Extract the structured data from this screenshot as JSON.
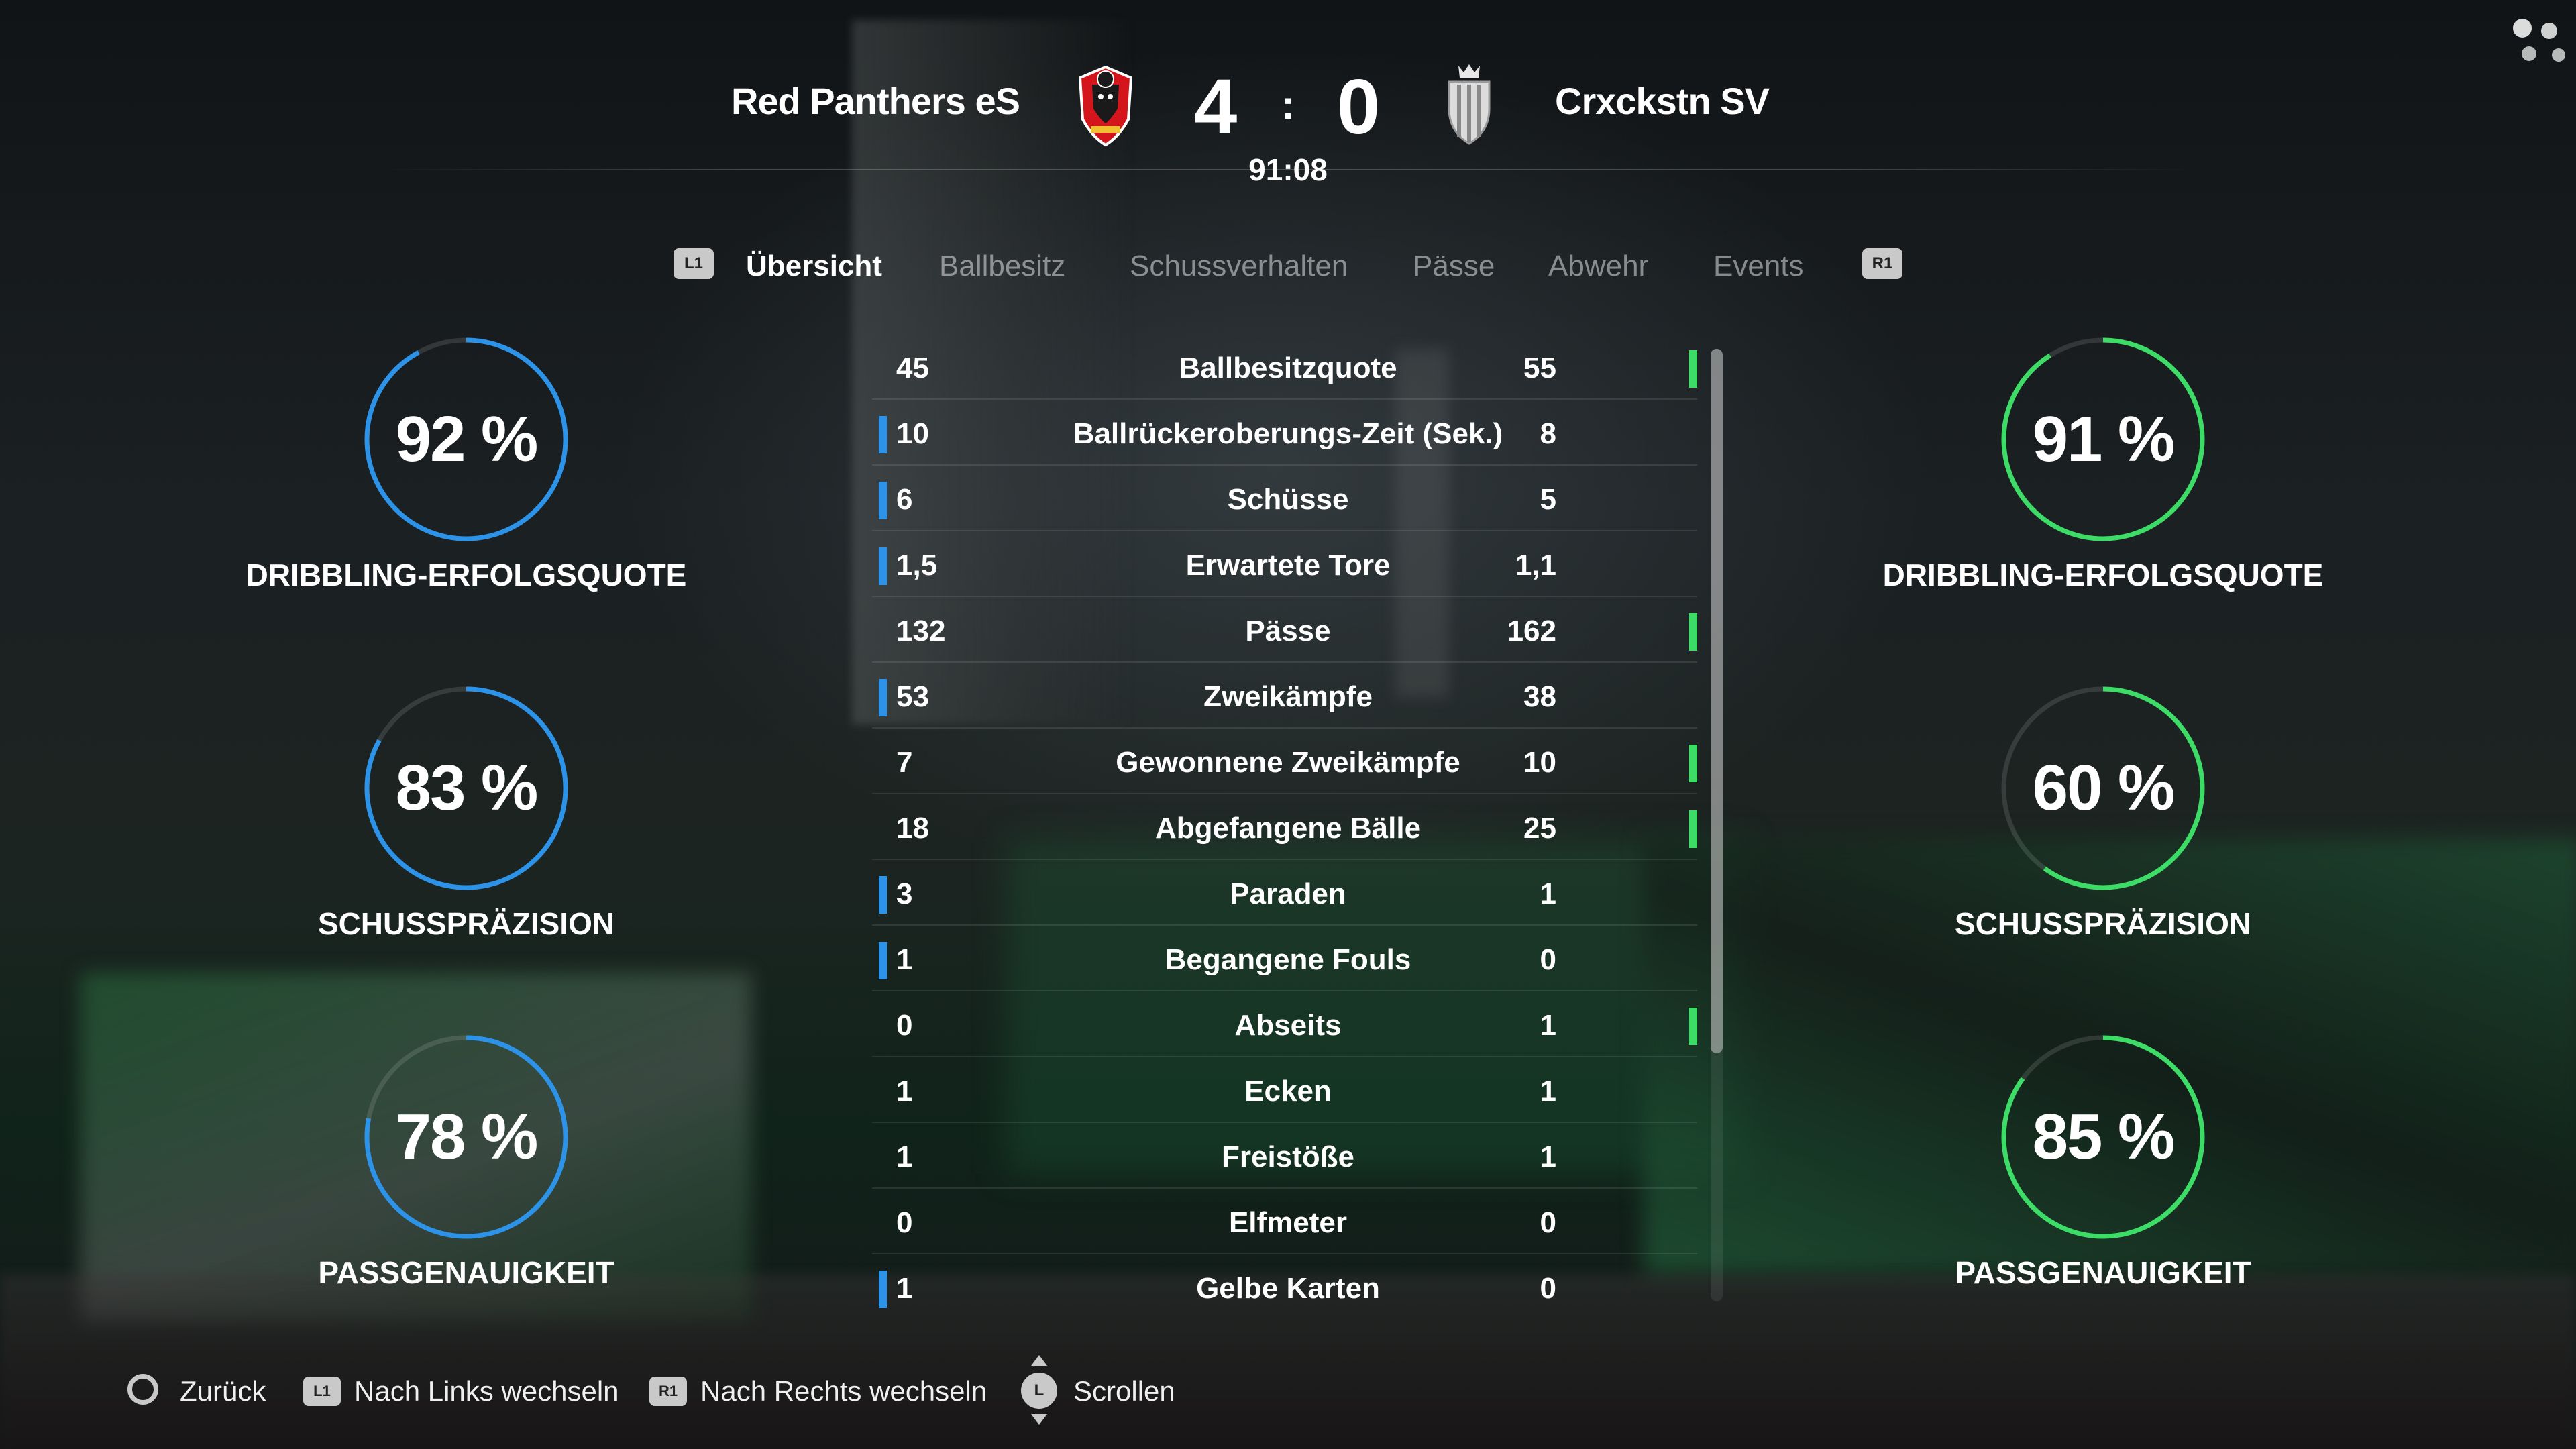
{
  "header": {
    "home_team": "Red Panthers eS",
    "away_team": "Crxckstn SV",
    "home_score": "4",
    "away_score": "0",
    "separator": ":",
    "clock": "91:08"
  },
  "tabs": {
    "left_button": "L1",
    "right_button": "R1",
    "items": [
      {
        "label": "Übersicht",
        "active": true
      },
      {
        "label": "Ballbesitz",
        "active": false
      },
      {
        "label": "Schussverhalten",
        "active": false
      },
      {
        "label": "Pässe",
        "active": false
      },
      {
        "label": "Abwehr",
        "active": false
      },
      {
        "label": "Events",
        "active": false
      }
    ]
  },
  "home_rings": [
    {
      "value": "92 %",
      "label": "DRIBBLING-ERFOLGSQUOTE",
      "percent": 92
    },
    {
      "value": "83 %",
      "label": "SCHUSSPRÄZISION",
      "percent": 83
    },
    {
      "value": "78 %",
      "label": "PASSGENAUIGKEIT",
      "percent": 78
    }
  ],
  "away_rings": [
    {
      "value": "91 %",
      "label": "DRIBBLING-ERFOLGSQUOTE",
      "percent": 91
    },
    {
      "value": "60 %",
      "label": "SCHUSSPRÄZISION",
      "percent": 60
    },
    {
      "value": "85 %",
      "label": "PASSGENAUIGKEIT",
      "percent": 85
    }
  ],
  "stats": [
    {
      "label": "Ballbesitzquote",
      "home": "45",
      "away": "55",
      "leader": "away"
    },
    {
      "label": "Ballrückeroberungs-Zeit (Sek.)",
      "home": "10",
      "away": "8",
      "leader": "home"
    },
    {
      "label": "Schüsse",
      "home": "6",
      "away": "5",
      "leader": "home"
    },
    {
      "label": "Erwartete Tore",
      "home": "1,5",
      "away": "1,1",
      "leader": "home"
    },
    {
      "label": "Pässe",
      "home": "132",
      "away": "162",
      "leader": "away"
    },
    {
      "label": "Zweikämpfe",
      "home": "53",
      "away": "38",
      "leader": "home"
    },
    {
      "label": "Gewonnene Zweikämpfe",
      "home": "7",
      "away": "10",
      "leader": "away"
    },
    {
      "label": "Abgefangene Bälle",
      "home": "18",
      "away": "25",
      "leader": "away"
    },
    {
      "label": "Paraden",
      "home": "3",
      "away": "1",
      "leader": "home"
    },
    {
      "label": "Begangene Fouls",
      "home": "1",
      "away": "0",
      "leader": "home"
    },
    {
      "label": "Abseits",
      "home": "0",
      "away": "1",
      "leader": "away"
    },
    {
      "label": "Ecken",
      "home": "1",
      "away": "1",
      "leader": "none"
    },
    {
      "label": "Freistöße",
      "home": "1",
      "away": "1",
      "leader": "none"
    },
    {
      "label": "Elfmeter",
      "home": "0",
      "away": "0",
      "leader": "none"
    },
    {
      "label": "Gelbe Karten",
      "home": "1",
      "away": "0",
      "leader": "home"
    }
  ],
  "footer": {
    "back": "Zurück",
    "switch_left_button": "L1",
    "switch_left": "Nach Links wechseln",
    "switch_right_button": "R1",
    "switch_right": "Nach Rechts wechseln",
    "scroll_button": "L",
    "scroll": "Scrollen"
  },
  "colors": {
    "home_accent": "#2c93e8",
    "away_accent": "#3ddc66"
  },
  "icons": {
    "home_crest": "red-panther-crest-icon",
    "away_crest": "crowned-shield-crest-icon",
    "back_button": "circle-button-icon",
    "scroll_stick": "left-stick-icon"
  }
}
